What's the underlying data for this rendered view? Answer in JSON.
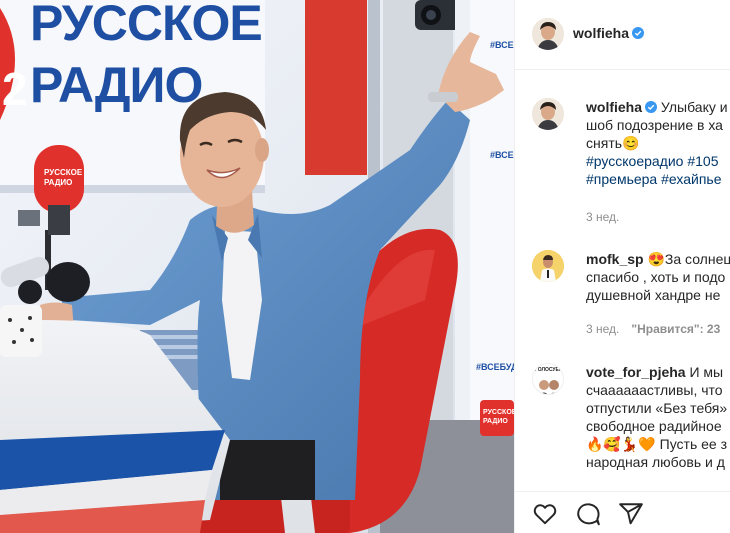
{
  "photo": {
    "studio_logo_line1": "РУССКОЕ",
    "studio_logo_line2": "РАДИО",
    "mic_logo_line1": "РУССКОЕ",
    "mic_logo_line2": "РАДИО",
    "side_tags": [
      "#ВСЕБ",
      "#ВСЕБ",
      "#ВСЕБУД"
    ],
    "side_logo_line1": "РУССКОЕ",
    "side_logo_line2": "РАДИО"
  },
  "header": {
    "username": "wolfieha",
    "verified": true
  },
  "caption": {
    "username": "wolfieha",
    "text_line1": "Улыбаку и",
    "text_line2": "шоб подозрение в ха",
    "text_line3": "снять",
    "emoji": "😊",
    "hashtags_line1": "#русскоерадио #105",
    "hashtags_line2": "#премьера #ехайпье",
    "time": "3 нед."
  },
  "comments": [
    {
      "username": "mofk_sp",
      "emoji": "😍",
      "line1": "За солнец",
      "line2": "спасибо , хоть и подо",
      "line3": "душевной хандре не",
      "time": "3 нед.",
      "likes": "\"Нравится\": 23"
    },
    {
      "username": "vote_for_pjeha",
      "line1": "И мы",
      "line2": "счаааааастливы, что",
      "line3": "отпустили «Без тебя»",
      "line4": "свободное радийное",
      "emoji_row": "🔥🥰💃🧡",
      "line5_after_emoji": "Пусть ее з",
      "line6": "народная любовь и д",
      "avatar_text": "ГОЛОСУЕМ"
    }
  ],
  "actions": {
    "like_icon": "heart-icon",
    "comment_icon": "comment-icon",
    "share_icon": "share-icon"
  },
  "colors": {
    "accent_red": "#e1312c",
    "studio_blue": "#1e4fa3",
    "shirt_blue": "#5b8fc7",
    "verified_blue": "#3897f0",
    "hashtag": "#00376b"
  }
}
